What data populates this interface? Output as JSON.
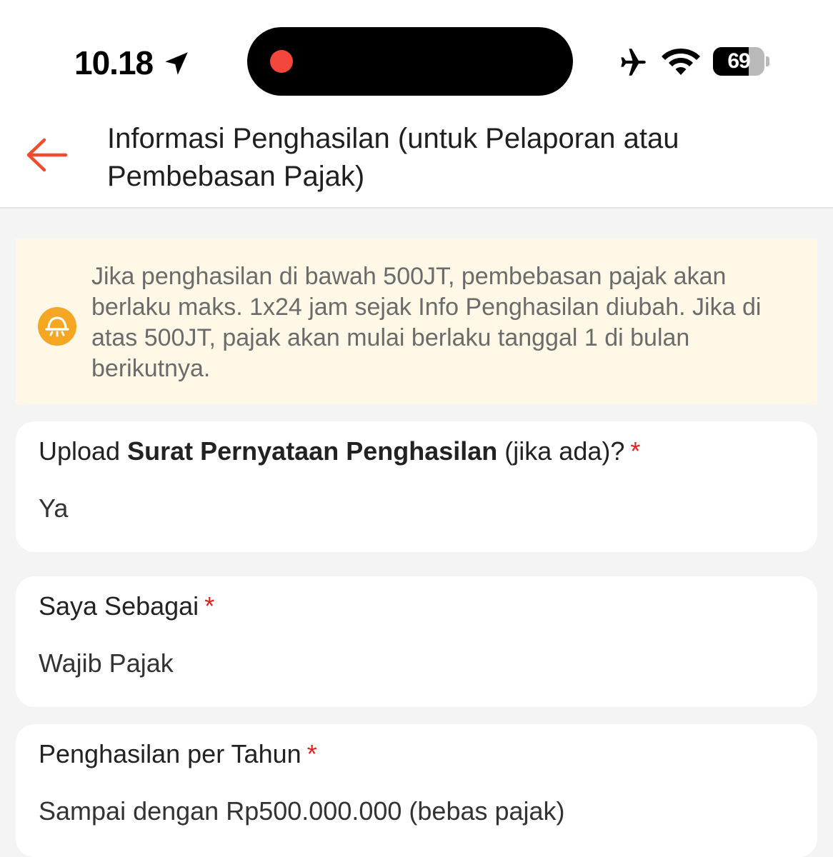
{
  "status_bar": {
    "time": "10.18",
    "battery_percent": "69",
    "battery_level": 0.69,
    "icons": [
      "location-arrow-icon",
      "recording-dot-icon",
      "airplane-icon",
      "wifi-icon",
      "battery-icon"
    ]
  },
  "header": {
    "title": "Informasi Penghasilan (untuk Pelaporan atau Pembebasan Pajak)",
    "back_icon": "arrow-left-icon"
  },
  "notice": {
    "icon": "bell-icon",
    "text": "Jika penghasilan di bawah 500JT, pembebasan pajak akan berlaku maks. 1x24 jam sejak Info Penghasilan diubah. Jika di atas 500JT, pajak akan mulai berlaku tanggal 1 di bulan berikutnya."
  },
  "fields": [
    {
      "label_prefix": "Upload ",
      "label_bold": "Surat Pernyataan Penghasilan",
      "label_suffix": " (jika ada)?",
      "required_mark": "*",
      "value": "Ya"
    },
    {
      "label": "Saya Sebagai",
      "required_mark": "*",
      "value": "Wajib Pajak"
    },
    {
      "label": "Penghasilan per Tahun",
      "required_mark": "*",
      "value": "Sampai dengan Rp500.000.000 (bebas pajak)"
    }
  ],
  "colors": {
    "accent": "#ee4d2d",
    "notice_bg": "#fff8e6",
    "notice_icon": "#f5a623",
    "required": "#e02020",
    "recording": "#f2473a"
  }
}
